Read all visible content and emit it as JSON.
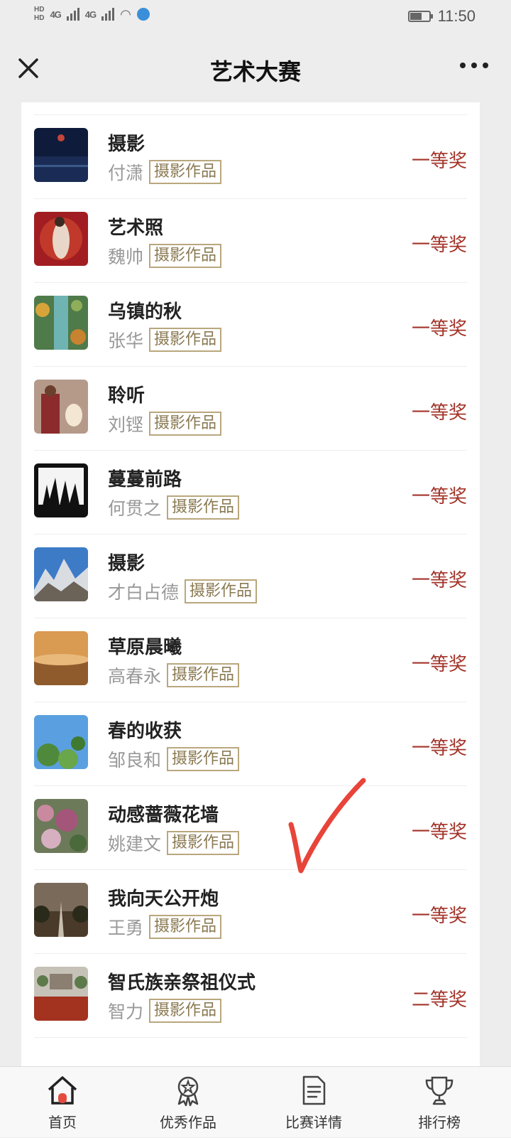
{
  "status_bar": {
    "hd_top": "HD",
    "hd_bottom": "HD",
    "net1": "4G",
    "net2": "4G",
    "time": "11:50"
  },
  "nav": {
    "title": "艺术大赛",
    "close_icon": "close-icon",
    "more_icon": "more-icon"
  },
  "entries": [
    {
      "title": "摄影",
      "author": "付潇",
      "tag": "摄影作品",
      "award": "一等奖"
    },
    {
      "title": "艺术照",
      "author": "魏帅",
      "tag": "摄影作品",
      "award": "一等奖"
    },
    {
      "title": "乌镇的秋",
      "author": "张华",
      "tag": "摄影作品",
      "award": "一等奖"
    },
    {
      "title": "聆听",
      "author": "刘铿",
      "tag": "摄影作品",
      "award": "一等奖"
    },
    {
      "title": "蔓蔓前路",
      "author": "何贯之",
      "tag": "摄影作品",
      "award": "一等奖"
    },
    {
      "title": "摄影",
      "author": "才白占德",
      "tag": "摄影作品",
      "award": "一等奖"
    },
    {
      "title": "草原晨曦",
      "author": "高春永",
      "tag": "摄影作品",
      "award": "一等奖"
    },
    {
      "title": "春的收获",
      "author": "邹良和",
      "tag": "摄影作品",
      "award": "一等奖"
    },
    {
      "title": "动感蔷薇花墙",
      "author": "姚建文",
      "tag": "摄影作品",
      "award": "一等奖"
    },
    {
      "title": "我向天公开炮",
      "author": "王勇",
      "tag": "摄影作品",
      "award": "一等奖"
    },
    {
      "title": "智氏族亲祭祖仪式",
      "author": "智力",
      "tag": "摄影作品",
      "award": "二等奖"
    }
  ],
  "tabs": [
    {
      "label": "首页",
      "icon": "home-icon"
    },
    {
      "label": "优秀作品",
      "icon": "medal-icon"
    },
    {
      "label": "比赛详情",
      "icon": "document-icon"
    },
    {
      "label": "排行榜",
      "icon": "trophy-icon"
    }
  ],
  "colors": {
    "award": "#a3342a",
    "tag_border": "#b9a77d",
    "annotation_check": "#e8443a"
  }
}
